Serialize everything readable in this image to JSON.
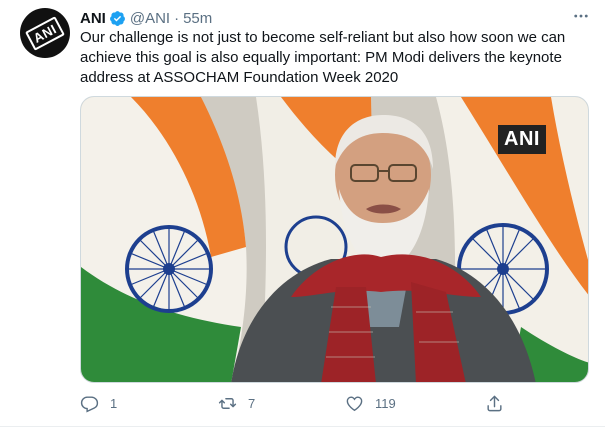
{
  "tweet": {
    "avatar_label": "ANI",
    "name": "ANI",
    "handle": "@ANI",
    "separator": "·",
    "time": "55m",
    "text": "Our challenge is not just to become self-reliant but also how soon we can achieve this goal is also equally important: PM Modi delivers the keynote address at ASSOCHAM Foundation Week 2020",
    "media": {
      "watermark": "ANI"
    }
  },
  "actions": {
    "reply_count": "1",
    "retweet_count": "7",
    "like_count": "119"
  },
  "colors": {
    "accent": "#1da1f2",
    "secondary_text": "#5b7083",
    "saffron": "#ef7f2d",
    "green": "#2f8b3a",
    "chakra": "#1d3f8f"
  },
  "icons": {
    "verified": "verified-badge-icon",
    "more": "more-icon",
    "reply": "reply-icon",
    "retweet": "retweet-icon",
    "like": "like-icon",
    "share": "share-icon"
  }
}
